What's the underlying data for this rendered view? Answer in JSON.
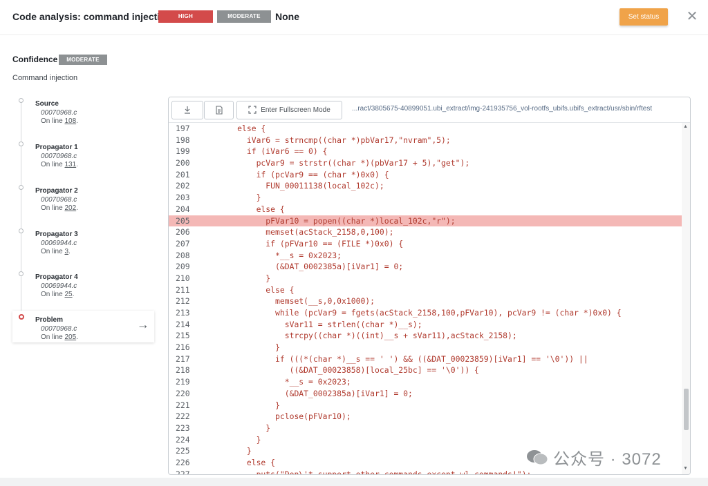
{
  "header": {
    "title": "Code analysis: command injection",
    "severity_high": "HIGH",
    "severity_moderate": "MODERATE",
    "status_value": "None",
    "set_status_label": "Set status",
    "close_icon": "close-icon"
  },
  "confidence": {
    "label": "Confidence",
    "value": "MODERATE"
  },
  "cwe_label": "Command injection",
  "flow": [
    {
      "name": "Source",
      "file": "00070968.c",
      "line_prefix": "On line ",
      "line": "108",
      "line_suffix": "."
    },
    {
      "name": "Propagator 1",
      "file": "00070968.c",
      "line_prefix": "On line ",
      "line": "131",
      "line_suffix": "."
    },
    {
      "name": "Propagator 2",
      "file": "00070968.c",
      "line_prefix": "On line ",
      "line": "202",
      "line_suffix": "."
    },
    {
      "name": "Propagator 3",
      "file": "00069944.c",
      "line_prefix": "On line ",
      "line": "3",
      "line_suffix": "."
    },
    {
      "name": "Propagator 4",
      "file": "00069944.c",
      "line_prefix": "On line ",
      "line": "25",
      "line_suffix": "."
    },
    {
      "name": "Problem",
      "file": "00070968.c",
      "line_prefix": "On line ",
      "line": "205",
      "line_suffix": "."
    }
  ],
  "toolbar": {
    "download_icon": "download-icon",
    "file_icon": "file-icon",
    "fullscreen_icon": "fullscreen-icon",
    "fullscreen_label": "Enter Fullscreen Mode",
    "file_path": "...ract/3805675-40899051.ubi_extract/img-241935756_vol-rootfs_ubifs.ubifs_extract/usr/sbin/rftest"
  },
  "code": {
    "highlight_line": "205",
    "lines": [
      {
        "n": "197",
        "t": "      else {"
      },
      {
        "n": "198",
        "t": "        iVar6 = strncmp((char *)pbVar17,\"nvram\",5);"
      },
      {
        "n": "199",
        "t": "        if (iVar6 == 0) {"
      },
      {
        "n": "200",
        "t": "          pcVar9 = strstr((char *)(pbVar17 + 5),\"get\");"
      },
      {
        "n": "201",
        "t": "          if (pcVar9 == (char *)0x0) {"
      },
      {
        "n": "202",
        "t": "            FUN_00011138(local_102c);"
      },
      {
        "n": "203",
        "t": "          }"
      },
      {
        "n": "204",
        "t": "          else {"
      },
      {
        "n": "205",
        "t": "            pFVar10 = popen((char *)local_102c,\"r\");"
      },
      {
        "n": "206",
        "t": "            memset(acStack_2158,0,100);"
      },
      {
        "n": "207",
        "t": "            if (pFVar10 == (FILE *)0x0) {"
      },
      {
        "n": "208",
        "t": "              *__s = 0x2023;"
      },
      {
        "n": "209",
        "t": "              (&DAT_0002385a)[iVar1] = 0;"
      },
      {
        "n": "210",
        "t": "            }"
      },
      {
        "n": "211",
        "t": "            else {"
      },
      {
        "n": "212",
        "t": "              memset(__s,0,0x1000);"
      },
      {
        "n": "213",
        "t": "              while (pcVar9 = fgets(acStack_2158,100,pFVar10), pcVar9 != (char *)0x0) {"
      },
      {
        "n": "214",
        "t": "                sVar11 = strlen((char *)__s);"
      },
      {
        "n": "215",
        "t": "                strcpy((char *)((int)__s + sVar11),acStack_2158);"
      },
      {
        "n": "216",
        "t": "              }"
      },
      {
        "n": "217",
        "t": "              if (((*(char *)__s == ' ') && ((&DAT_00023859)[iVar1] == '\\0')) ||"
      },
      {
        "n": "218",
        "t": "                 ((&DAT_00023858)[local_25bc] == '\\0')) {"
      },
      {
        "n": "219",
        "t": "                *__s = 0x2023;"
      },
      {
        "n": "220",
        "t": "                (&DAT_0002385a)[iVar1] = 0;"
      },
      {
        "n": "221",
        "t": "              }"
      },
      {
        "n": "222",
        "t": "              pclose(pFVar10);"
      },
      {
        "n": "223",
        "t": "            }"
      },
      {
        "n": "224",
        "t": "          }"
      },
      {
        "n": "225",
        "t": "        }"
      },
      {
        "n": "226",
        "t": "        else {"
      },
      {
        "n": "227",
        "t": "          puts(\"Don\\'t support other commands except wl commands!\");"
      }
    ]
  },
  "watermark": "公众号 · 3072",
  "colors": {
    "high": "#d34a4a",
    "moderate": "#8d9193",
    "set_status": "#f0a349",
    "highlight": "#f4b8b6",
    "code_text": "#b03a2e"
  }
}
